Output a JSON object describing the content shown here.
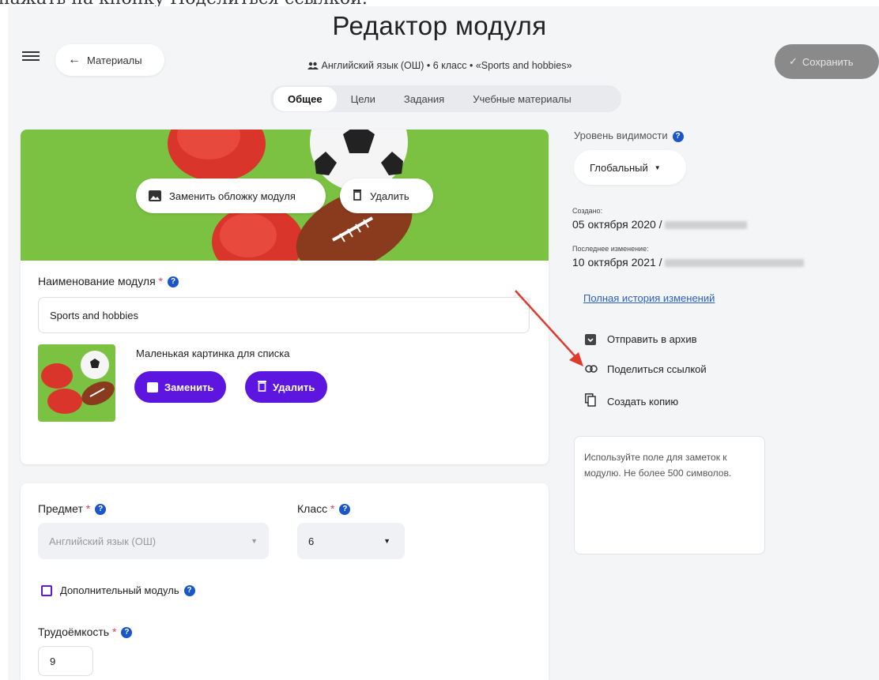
{
  "caption_fragment": "нажать на кнопку Поделиться ссылкой.",
  "page_title": "Редактор модуля",
  "header": {
    "back_label": "Материалы",
    "breadcrumb": "Английский язык (ОШ) • 6 класс • «Sports and hobbies»",
    "save_label": "Сохранить"
  },
  "tabs": [
    {
      "label": "Общее",
      "active": true
    },
    {
      "label": "Цели",
      "active": false
    },
    {
      "label": "Задания",
      "active": false
    },
    {
      "label": "Учебные материалы",
      "active": false
    }
  ],
  "cover": {
    "replace_label": "Заменить обложку модуля",
    "delete_label": "Удалить"
  },
  "module_name": {
    "label": "Наименование модуля",
    "required": "*",
    "value": "Sports and hobbies"
  },
  "thumbnail": {
    "label": "Маленькая картинка для списка",
    "replace_label": "Заменить",
    "delete_label": "Удалить"
  },
  "subject": {
    "label": "Предмет",
    "required": "*",
    "value": "Английский язык (ОШ)"
  },
  "grade": {
    "label": "Класс",
    "required": "*",
    "value": "6"
  },
  "additional_module": {
    "label": "Дополнительный модуль",
    "checked": false
  },
  "workload": {
    "label": "Трудоёмкость",
    "required": "*",
    "value": "9"
  },
  "sidebar": {
    "visibility_label": "Уровень видимости",
    "visibility_value": "Глобальный",
    "created_label": "Создано:",
    "created_value": "05 октября 2020 /",
    "modified_label": "Последнее изменение:",
    "modified_value": "10 октября 2021 /",
    "history_link": "Полная история изменений",
    "actions": [
      {
        "label": "Отправить в архив",
        "icon": "archive-icon"
      },
      {
        "label": "Поделиться ссылкой",
        "icon": "link-icon"
      },
      {
        "label": "Создать копию",
        "icon": "copy-icon"
      }
    ],
    "notes_placeholder": "Используйте поле для заметок к модулю. Не более 500 символов."
  },
  "colors": {
    "accent_purple": "#5c16e0",
    "help_blue": "#1a56c9",
    "cover_green": "#7bc142",
    "annotation_arrow": "#e03a2f"
  }
}
